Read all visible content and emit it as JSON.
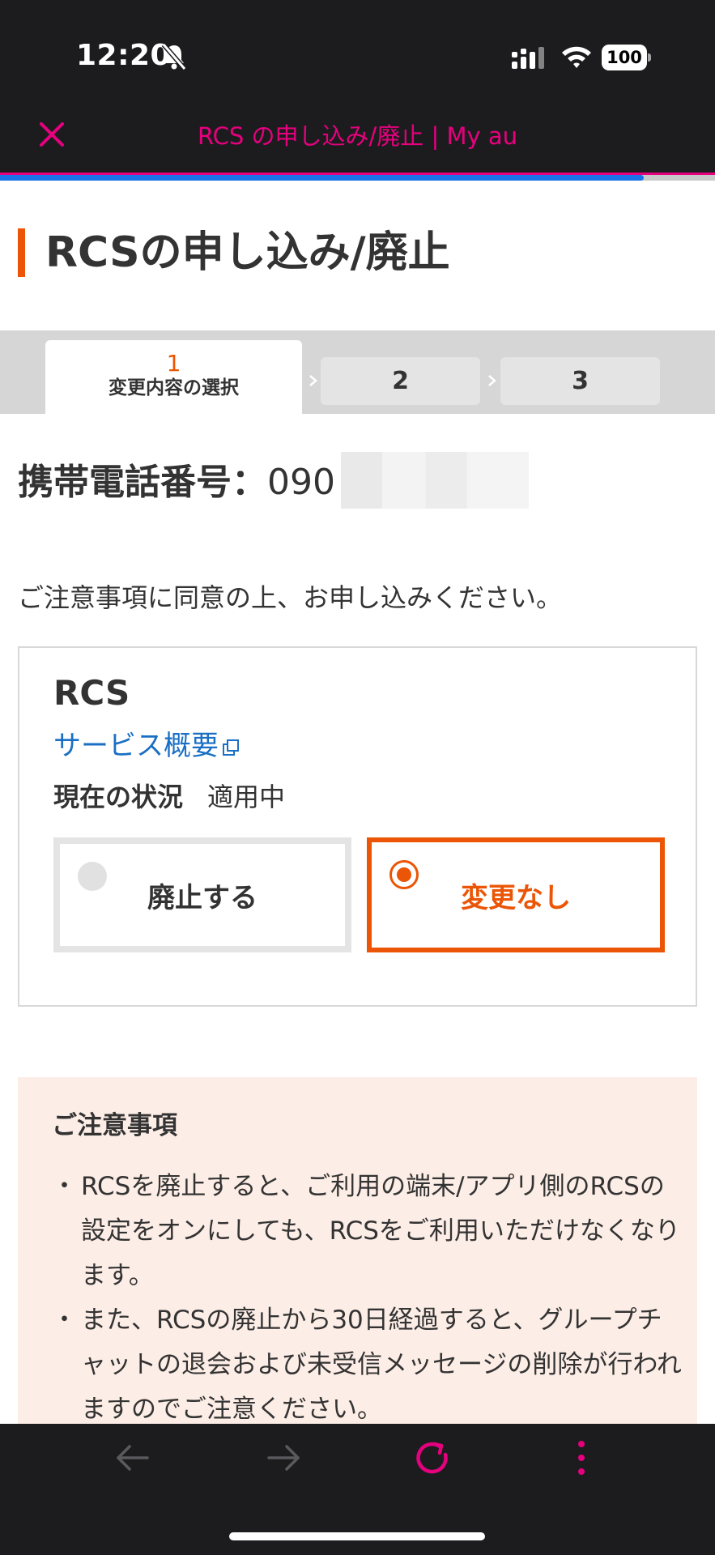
{
  "status_bar": {
    "time": "12:20",
    "battery": "100"
  },
  "browser": {
    "title": "RCS の申し込み/廃止 | My au",
    "load_progress": 0.9
  },
  "page": {
    "heading": "RCSの申し込み/廃止"
  },
  "stepper": {
    "active_number": "1",
    "active_label": "変更内容の選択",
    "step2": "2",
    "step3": "3"
  },
  "phone": {
    "label": "携帯電話番号：",
    "value": "090"
  },
  "notice": "ご注意事項に同意の上、お申し込みください。",
  "rcs_card": {
    "title": "RCS",
    "service_link": "サービス概要",
    "status_label": "現在の状況",
    "status_value": "適用中",
    "option_cancel": "廃止する",
    "option_no_change": "変更なし",
    "selected": "変更なし"
  },
  "caution": {
    "title": "ご注意事項",
    "items": [
      "RCSを廃止すると、ご利用の端末/アプリ側のRCSの設定をオンにしても、RCSをご利用いただけなくなります。",
      "また、RCSの廃止から30日経過すると、グループチャットの退会および未受信メッセージの削除が行われますのでご注意ください。"
    ]
  },
  "colors": {
    "accent": "#eb5505",
    "brand_pink": "#e6007e",
    "link": "#1a6fc4"
  }
}
